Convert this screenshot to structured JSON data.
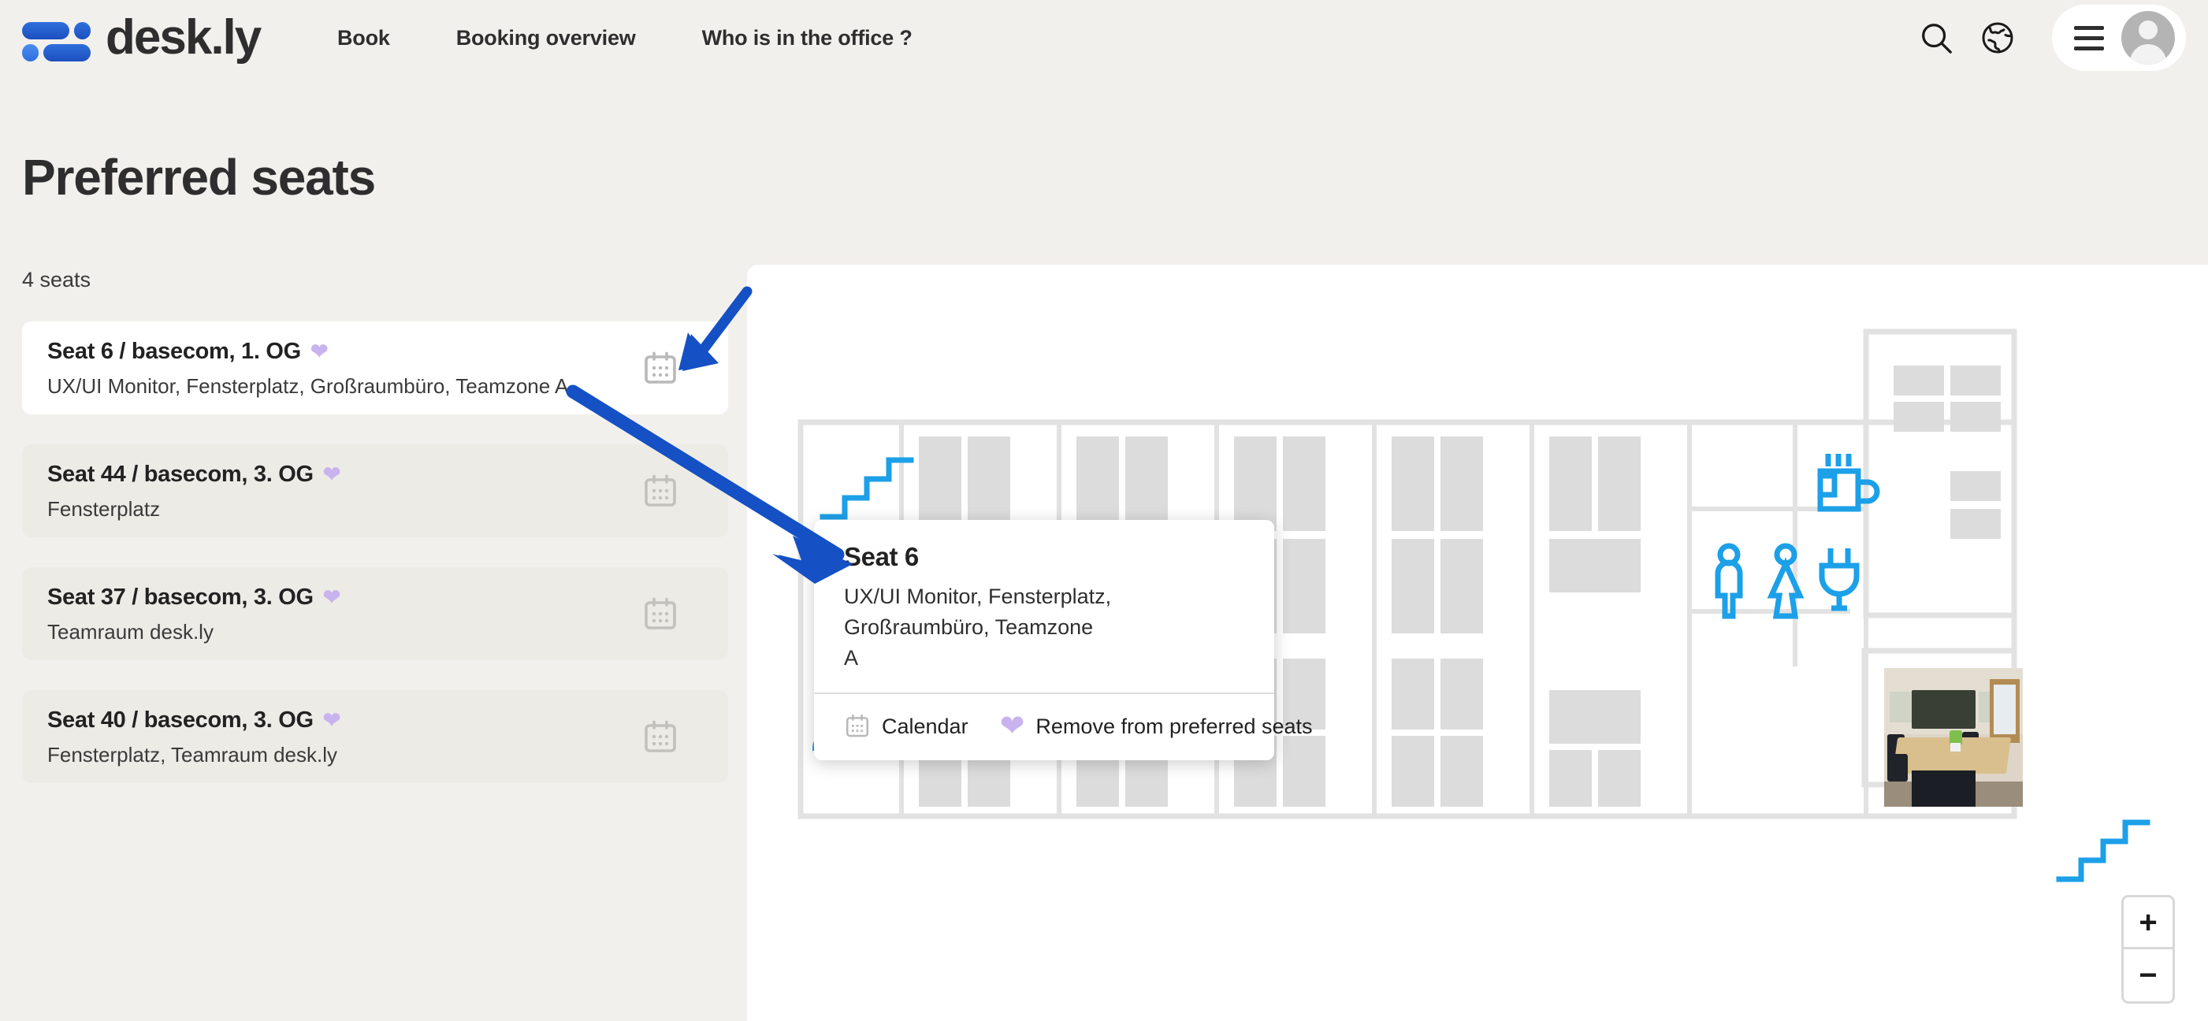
{
  "brand": {
    "name": "desk.ly",
    "logo_icon": "desk-ly-logo-icon"
  },
  "nav": {
    "links": [
      {
        "label": "Book"
      },
      {
        "label": "Booking overview"
      },
      {
        "label": "Who is in the office ?"
      }
    ],
    "search_icon": "search-icon",
    "language_icon": "globe-icon",
    "menu_icon": "hamburger-menu-icon",
    "avatar_icon": "user-avatar-icon"
  },
  "page": {
    "title": "Preferred seats",
    "count_label": "4 seats"
  },
  "seats": [
    {
      "title": "Seat 6 / basecom, 1. OG",
      "attributes": "UX/UI Monitor, Fensterplatz, Großraumbüro, Teamzone A",
      "favorite_icon": "heart-icon",
      "calendar_icon": "calendar-icon",
      "selected": true
    },
    {
      "title": "Seat 44 / basecom, 3. OG",
      "attributes": "Fensterplatz",
      "favorite_icon": "heart-icon",
      "calendar_icon": "calendar-icon",
      "selected": false
    },
    {
      "title": "Seat 37 / basecom, 3. OG",
      "attributes": "Teamraum desk.ly",
      "favorite_icon": "heart-icon",
      "calendar_icon": "calendar-icon",
      "selected": false
    },
    {
      "title": "Seat 40 / basecom, 3. OG",
      "attributes": "Fensterplatz, Teamraum desk.ly",
      "favorite_icon": "heart-icon",
      "calendar_icon": "calendar-icon",
      "selected": false
    }
  ],
  "popup": {
    "title": "Seat 6",
    "description": "UX/UI Monitor, Fensterplatz, Großraumbüro, Teamzone A",
    "calendar_label": "Calendar",
    "calendar_icon": "calendar-icon",
    "remove_label": "Remove from preferred seats",
    "remove_icon": "heart-icon"
  },
  "map": {
    "zoom_in_label": "+",
    "zoom_out_label": "−",
    "marker_icon": "heart-pin-marker-icon",
    "amenity_icons": [
      "stairs-icon",
      "meeting-people-icon",
      "wc-male-icon",
      "wc-female-icon",
      "coffee-icon",
      "power-plug-icon",
      "stairs-icon"
    ],
    "room_photo": "meeting-room-photo"
  },
  "annotations": {
    "arrow_1": "arrow-pointing-to-seat-calendar-icon",
    "arrow_2": "arrow-pointing-to-seat-popup"
  },
  "colors": {
    "page_background": "#f2f0ec",
    "panel_background": "#ffffff",
    "card_inactive": "#edebe6",
    "text_primary": "#2e2e2e",
    "brand_blue": "#1c4fbf",
    "accent_blue": "#1ca0e8",
    "favorite_purple": "#c9b3ef",
    "desk_gray": "#dcdcdc",
    "wall_gray": "#e0e0e0",
    "annotation_blue": "#1550c4"
  }
}
